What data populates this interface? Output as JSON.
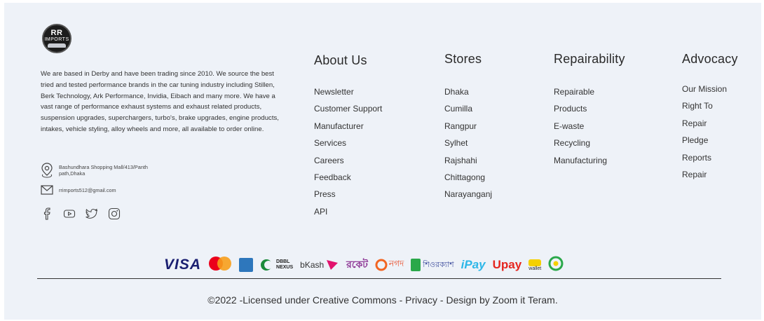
{
  "brand": {
    "logo_line1": "RR",
    "logo_line2": "IMPORTS"
  },
  "about_text": "We are based in Derby and have been trading since 2010. We source the best tried and tested performance brands in the car tuning industry including Stillen, Berk Technology, Ark Performance, Invidia, Eibach and many more. We have a vast range of performance exhaust systems and exhaust related products, suspension upgrades, superchargers, turbo's, brake upgrades, engine products, intakes, vehicle styling, alloy wheels and more, all available to order online.",
  "contact": {
    "address": "Bashundhara Shopping Mall/413/Panth path,Dhaka",
    "email": "rrimports512@gmail.com"
  },
  "social": [
    "facebook-icon",
    "youtube-icon",
    "twitter-icon",
    "instagram-icon"
  ],
  "columns": {
    "about": {
      "title": "About Us",
      "items": [
        "Newsletter",
        "Customer Support",
        "Manufacturer",
        "Services",
        "Careers",
        "Feedback",
        "Press",
        "API"
      ]
    },
    "stores": {
      "title": "Stores",
      "items": [
        "Dhaka",
        "Cumilla",
        "Rangpur",
        "Sylhet",
        "Rajshahi",
        "Chittagong",
        "Narayanganj"
      ]
    },
    "repairability": {
      "title": "Repairability",
      "items": [
        "Repairable",
        "Products",
        "E-waste",
        "Recycling",
        "Manufacturing"
      ]
    },
    "advocacy": {
      "title": "Advocacy",
      "items": [
        "Our Mission",
        "Right To",
        "Repair",
        "Pledge",
        "Reports",
        "Repair"
      ]
    }
  },
  "payments": {
    "visa": "VISA",
    "dbbl_line1": "DBBL",
    "dbbl_line2": "NEXUS",
    "bkash": "bKash",
    "rocket": "রকেট",
    "nagad": "নগদ",
    "shurecash": "শিওরক্যাশ",
    "ipay": "iPay",
    "upay": "Upay",
    "wallet": "wallet"
  },
  "colors": {
    "background": "#eef2f8",
    "visa": "#1a1f71",
    "mastercard_red": "#eb001b",
    "mastercard_orange": "#f79e1b",
    "bkash": "#e2136e",
    "ipay": "#2db7e8",
    "upay": "#e5261f"
  },
  "copyright": "©2022 -Licensed under Creative Commons - Privacy - Design by Zoom it Teram."
}
